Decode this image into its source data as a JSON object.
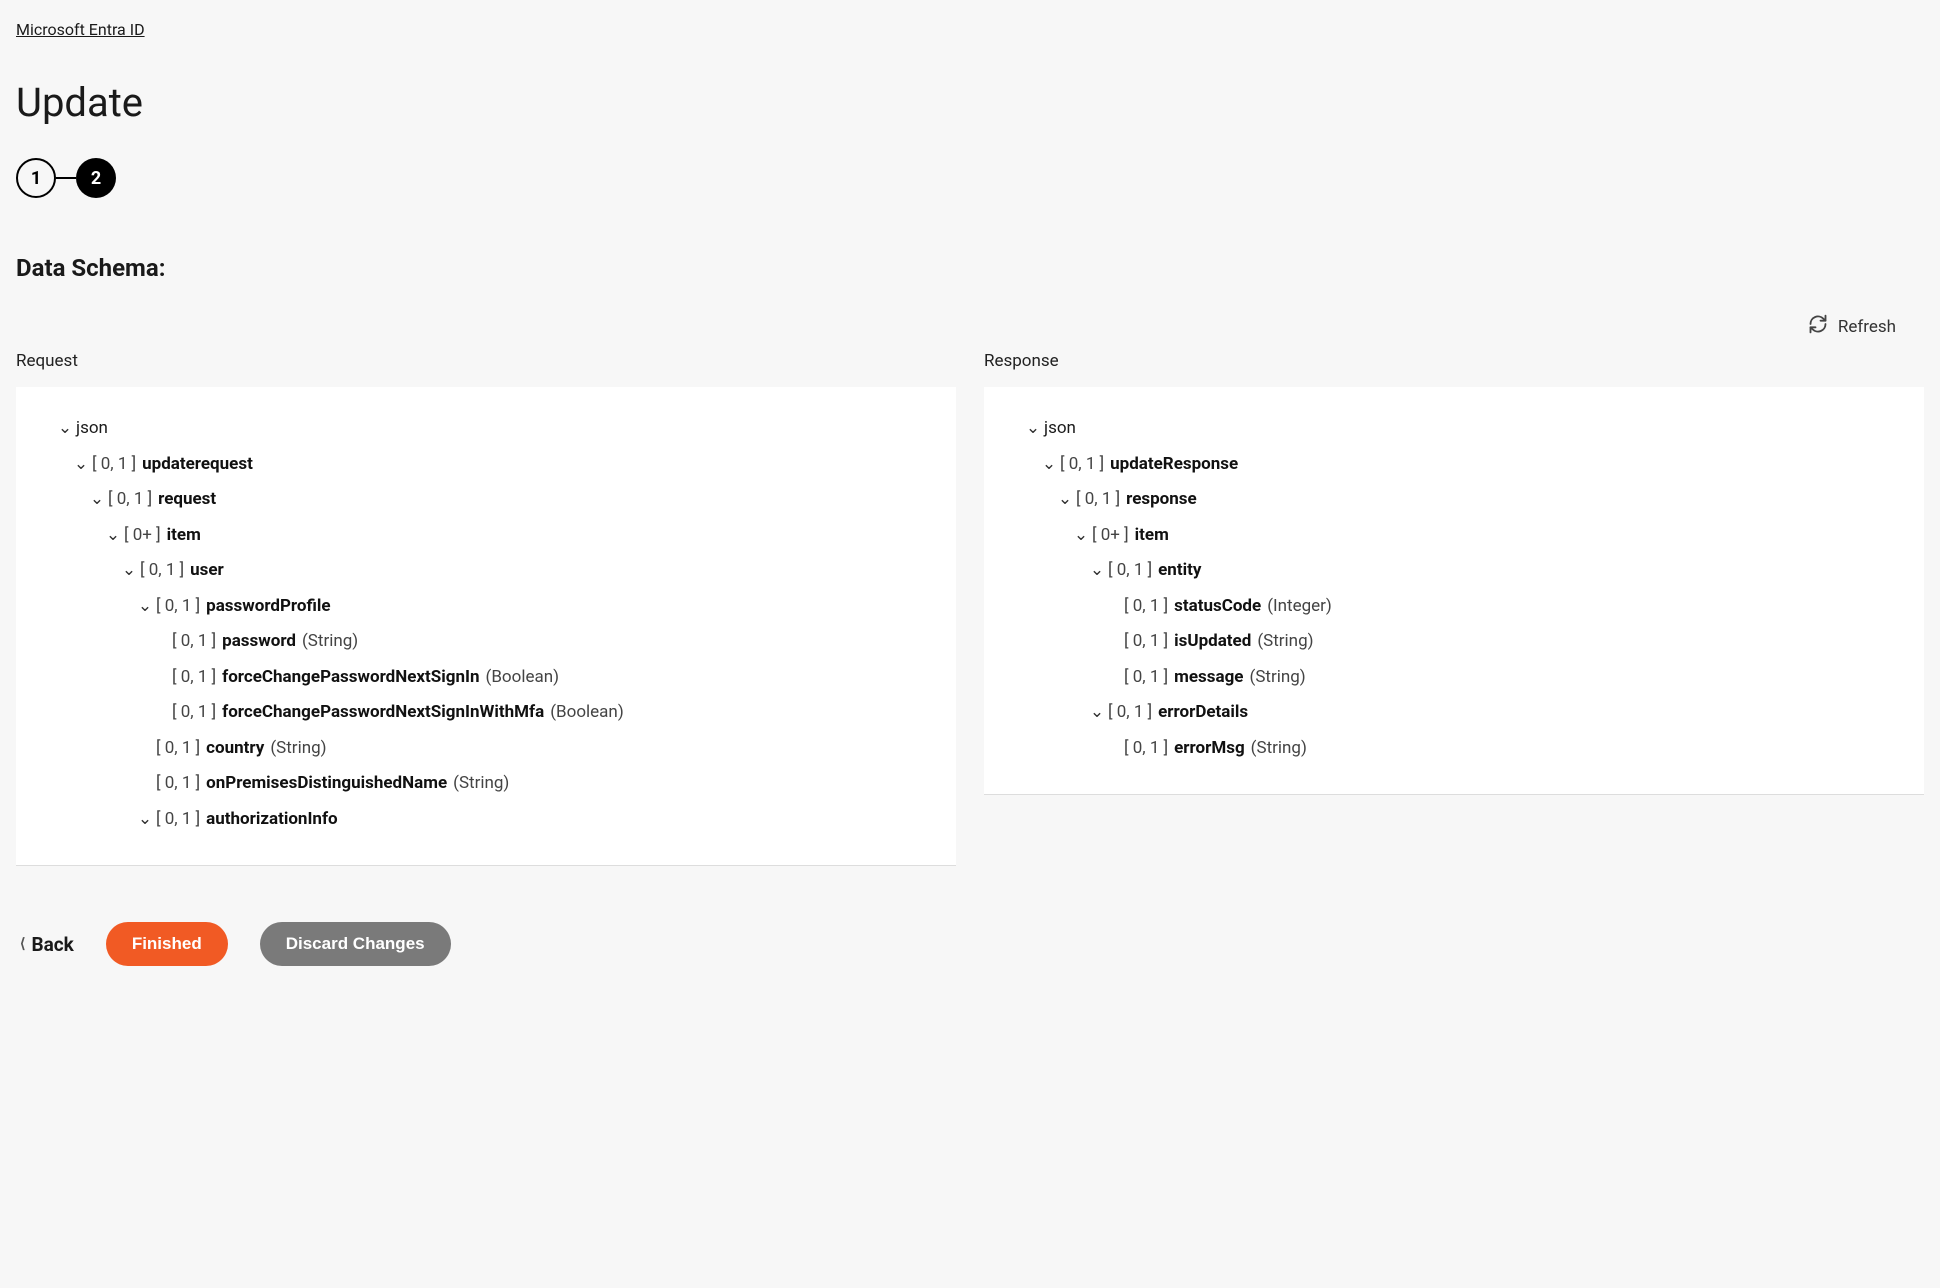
{
  "breadcrumb": "Microsoft Entra ID",
  "title": "Update",
  "stepper": {
    "step1": "1",
    "step2": "2"
  },
  "sectionTitle": "Data Schema:",
  "refresh": "Refresh",
  "panels": {
    "requestLabel": "Request",
    "responseLabel": "Response"
  },
  "requestTree": {
    "root": "json",
    "n1": {
      "card": "[ 0, 1 ]",
      "name": "updaterequest"
    },
    "n2": {
      "card": "[ 0, 1 ]",
      "name": "request"
    },
    "n3": {
      "card": "[ 0+ ]",
      "name": "item"
    },
    "n4": {
      "card": "[ 0, 1 ]",
      "name": "user"
    },
    "n5": {
      "card": "[ 0, 1 ]",
      "name": "passwordProfile"
    },
    "n6": {
      "card": "[ 0, 1 ]",
      "name": "password",
      "type": "(String)"
    },
    "n7": {
      "card": "[ 0, 1 ]",
      "name": "forceChangePasswordNextSignIn",
      "type": "(Boolean)"
    },
    "n8": {
      "card": "[ 0, 1 ]",
      "name": "forceChangePasswordNextSignInWithMfa",
      "type": "(Boolean)"
    },
    "n9": {
      "card": "[ 0, 1 ]",
      "name": "country",
      "type": "(String)"
    },
    "n10": {
      "card": "[ 0, 1 ]",
      "name": "onPremisesDistinguishedName",
      "type": "(String)"
    },
    "n11": {
      "card": "[ 0, 1 ]",
      "name": "authorizationInfo"
    }
  },
  "responseTree": {
    "root": "json",
    "n1": {
      "card": "[ 0, 1 ]",
      "name": "updateResponse"
    },
    "n2": {
      "card": "[ 0, 1 ]",
      "name": "response"
    },
    "n3": {
      "card": "[ 0+ ]",
      "name": "item"
    },
    "n4": {
      "card": "[ 0, 1 ]",
      "name": "entity"
    },
    "n5": {
      "card": "[ 0, 1 ]",
      "name": "statusCode",
      "type": "(Integer)"
    },
    "n6": {
      "card": "[ 0, 1 ]",
      "name": "isUpdated",
      "type": "(String)"
    },
    "n7": {
      "card": "[ 0, 1 ]",
      "name": "message",
      "type": "(String)"
    },
    "n8": {
      "card": "[ 0, 1 ]",
      "name": "errorDetails"
    },
    "n9": {
      "card": "[ 0, 1 ]",
      "name": "errorMsg",
      "type": "(String)"
    }
  },
  "footer": {
    "back": "Back",
    "finished": "Finished",
    "discard": "Discard Changes"
  }
}
